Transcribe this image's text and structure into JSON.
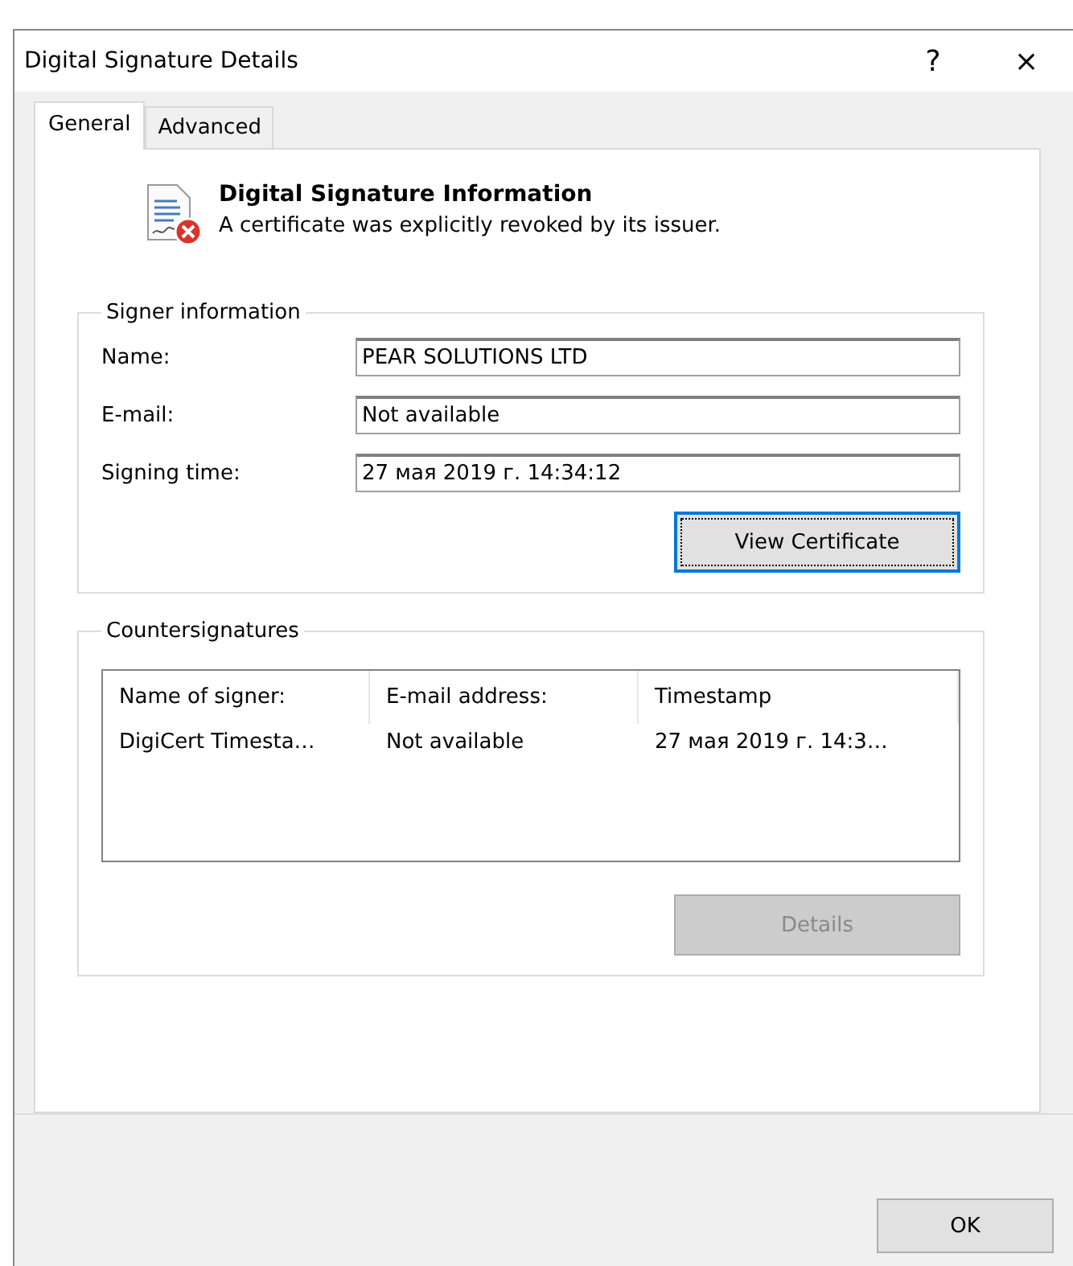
{
  "window": {
    "title": "Digital Signature Details",
    "help": "?",
    "close": "×"
  },
  "tabs": [
    {
      "label": "General",
      "selected": true
    },
    {
      "label": "Advanced",
      "selected": false
    }
  ],
  "header": {
    "title": "Digital Signature Information",
    "message": "A certificate was explicitly revoked by its issuer."
  },
  "signer_information": {
    "title": "Signer information",
    "fields": [
      {
        "label": "Name:",
        "value": "PEAR SOLUTIONS LTD"
      },
      {
        "label": "E-mail:",
        "value": "Not available"
      },
      {
        "label": "Signing time:",
        "value": "27 мая 2019 г. 14:34:12"
      }
    ],
    "button": {
      "label": "View Certificate",
      "focused": true,
      "disabled": false
    }
  },
  "countersignatures": {
    "title": "Countersignatures",
    "columns": [
      "Name of signer:",
      "E-mail address:",
      "Timestamp"
    ],
    "rows": [
      [
        "DigiCert Timesta…",
        "Not available",
        "27 мая 2019 г. 14:3…"
      ]
    ],
    "button": {
      "label": "Details",
      "focused": false,
      "disabled": true
    }
  },
  "footer": {
    "button": "OK"
  }
}
